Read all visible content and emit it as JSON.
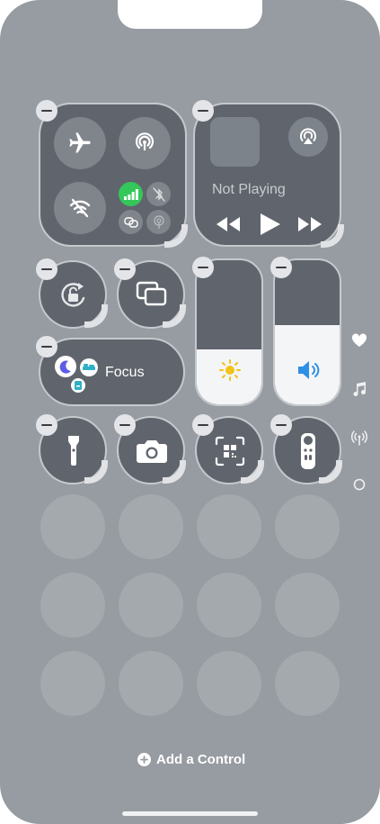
{
  "media": {
    "status": "Not Playing"
  },
  "focus": {
    "label": "Focus"
  },
  "footer": {
    "add_control_label": "Add a Control"
  },
  "colors": {
    "background": "#979ca2",
    "tile": "#60656d",
    "cellular_active": "#34c759",
    "volume_accent": "#2f8fe6",
    "brightness_accent": "#f2c318",
    "focus_moon": "#5e5ce6",
    "focus_bed": "#30b0c7"
  },
  "icons": {
    "connectivity": [
      "airplane-icon",
      "airdrop-icon",
      "wifi-off-icon",
      "cellular-icon",
      "bluetooth-off-icon",
      "screen-mirroring-link-icon",
      "hotspot-icon"
    ],
    "side_pages": [
      "heart-icon",
      "music-note-icon",
      "antenna-icon",
      "circle-icon"
    ],
    "controls": [
      "rotation-lock-icon",
      "screen-mirroring-icon",
      "flashlight-icon",
      "camera-icon",
      "qr-code-scanner-icon",
      "apple-tv-remote-icon"
    ]
  },
  "sliders": {
    "brightness_level": 0.38,
    "volume_level": 0.55
  },
  "placeholder_rows": 3,
  "placeholder_cols": 4
}
